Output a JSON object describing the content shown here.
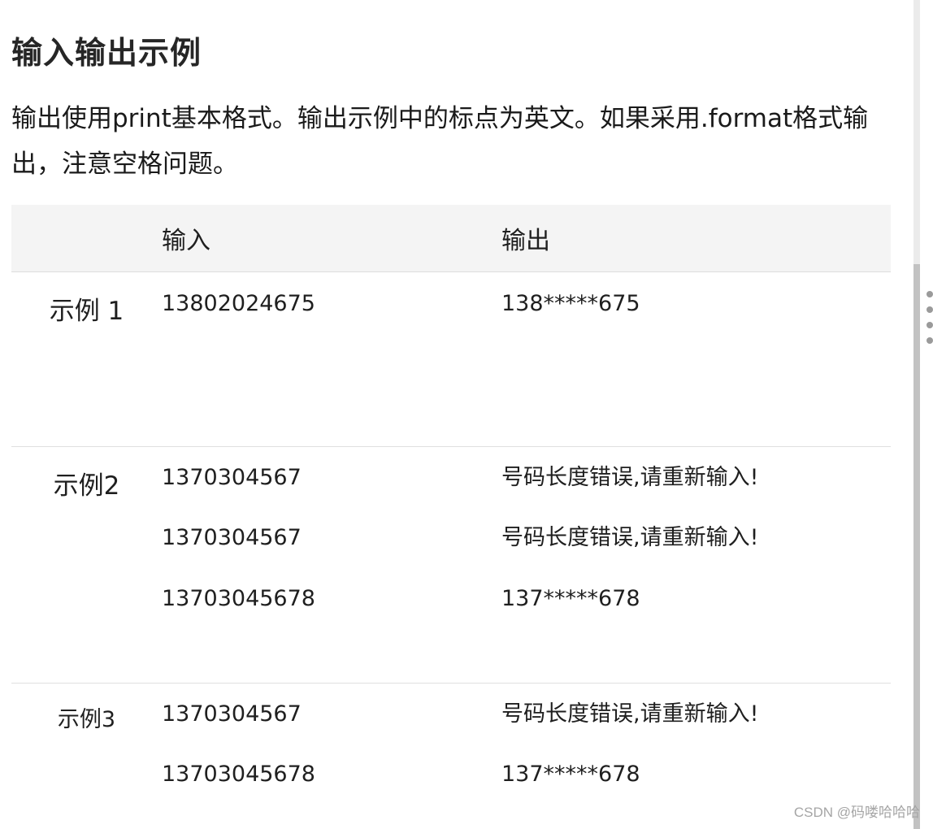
{
  "section": {
    "title": "输入输出示例",
    "description": "输出使用print基本格式。输出示例中的标点为英文。如果采用.format格式输出，注意空格问题。"
  },
  "table": {
    "headers": {
      "label": "",
      "input": "输入",
      "output": "输出"
    },
    "rows": [
      {
        "label": "示例 1",
        "inputs": [
          "13802024675"
        ],
        "outputs": [
          "138*****675"
        ]
      },
      {
        "label": "示例2",
        "inputs": [
          "1370304567",
          "1370304567",
          "13703045678"
        ],
        "outputs": [
          "号码长度错误,请重新输入!",
          "号码长度错误,请重新输入!",
          "137*****678"
        ]
      },
      {
        "label": "示例3",
        "inputs": [
          "1370304567",
          "13703045678"
        ],
        "outputs": [
          "号码长度错误,请重新输入!",
          "137*****678"
        ]
      }
    ]
  },
  "watermark": "CSDN @码喽哈哈哈",
  "icons": {
    "side_menu": "vertical-dots-icon"
  }
}
